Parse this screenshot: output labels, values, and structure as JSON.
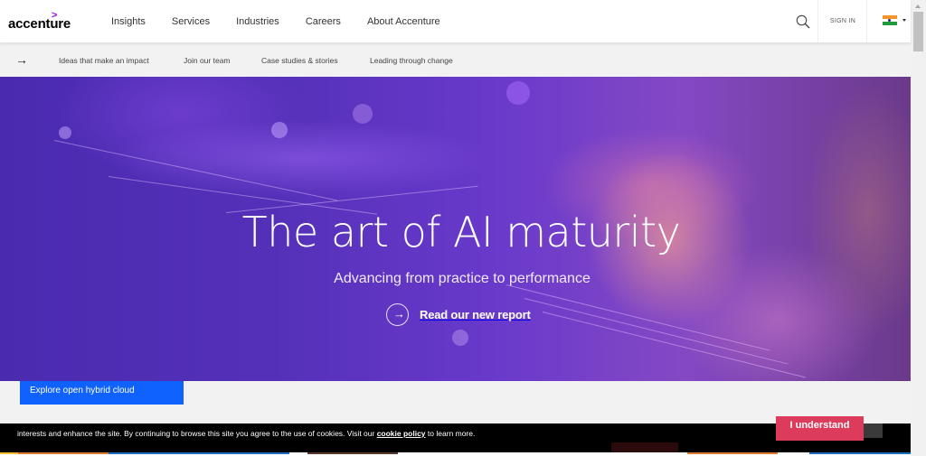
{
  "header": {
    "logo_text": "accenture",
    "logo_mark": ">",
    "nav_items": [
      {
        "label": "Insights"
      },
      {
        "label": "Services"
      },
      {
        "label": "Industries"
      },
      {
        "label": "Careers"
      },
      {
        "label": "About Accenture"
      }
    ],
    "search_icon": "search-icon",
    "sign_in_label": "SIGN IN",
    "country_flag": "india-flag-icon"
  },
  "subnav": {
    "arrow_icon": "arrow-right-icon",
    "arrow_glyph": "→",
    "items": [
      {
        "label": "Ideas that make an impact"
      },
      {
        "label": "Join our team"
      },
      {
        "label": "Case studies & stories"
      },
      {
        "label": "Leading through change"
      }
    ]
  },
  "hero": {
    "title": "The art of AI maturity",
    "subtitle": "Advancing from practice to performance",
    "cta_label": "Read our new report",
    "cta_icon": "circle-arrow-right-icon",
    "cta_glyph": "→"
  },
  "explore_button": {
    "label": "Explore open hybrid cloud"
  },
  "cookie_banner": {
    "text_before": "interests and enhance the site. By continuing to browse this site you agree to the use of cookies. Visit our ",
    "link_label": "cookie policy",
    "text_after": " to learn more.",
    "accept_label": "I understand"
  },
  "colors": {
    "brand_purple": "#a100ff",
    "explore_blue": "#0f62fe",
    "accept_red": "#dc3b5b",
    "cookie_bg": "#000000"
  }
}
